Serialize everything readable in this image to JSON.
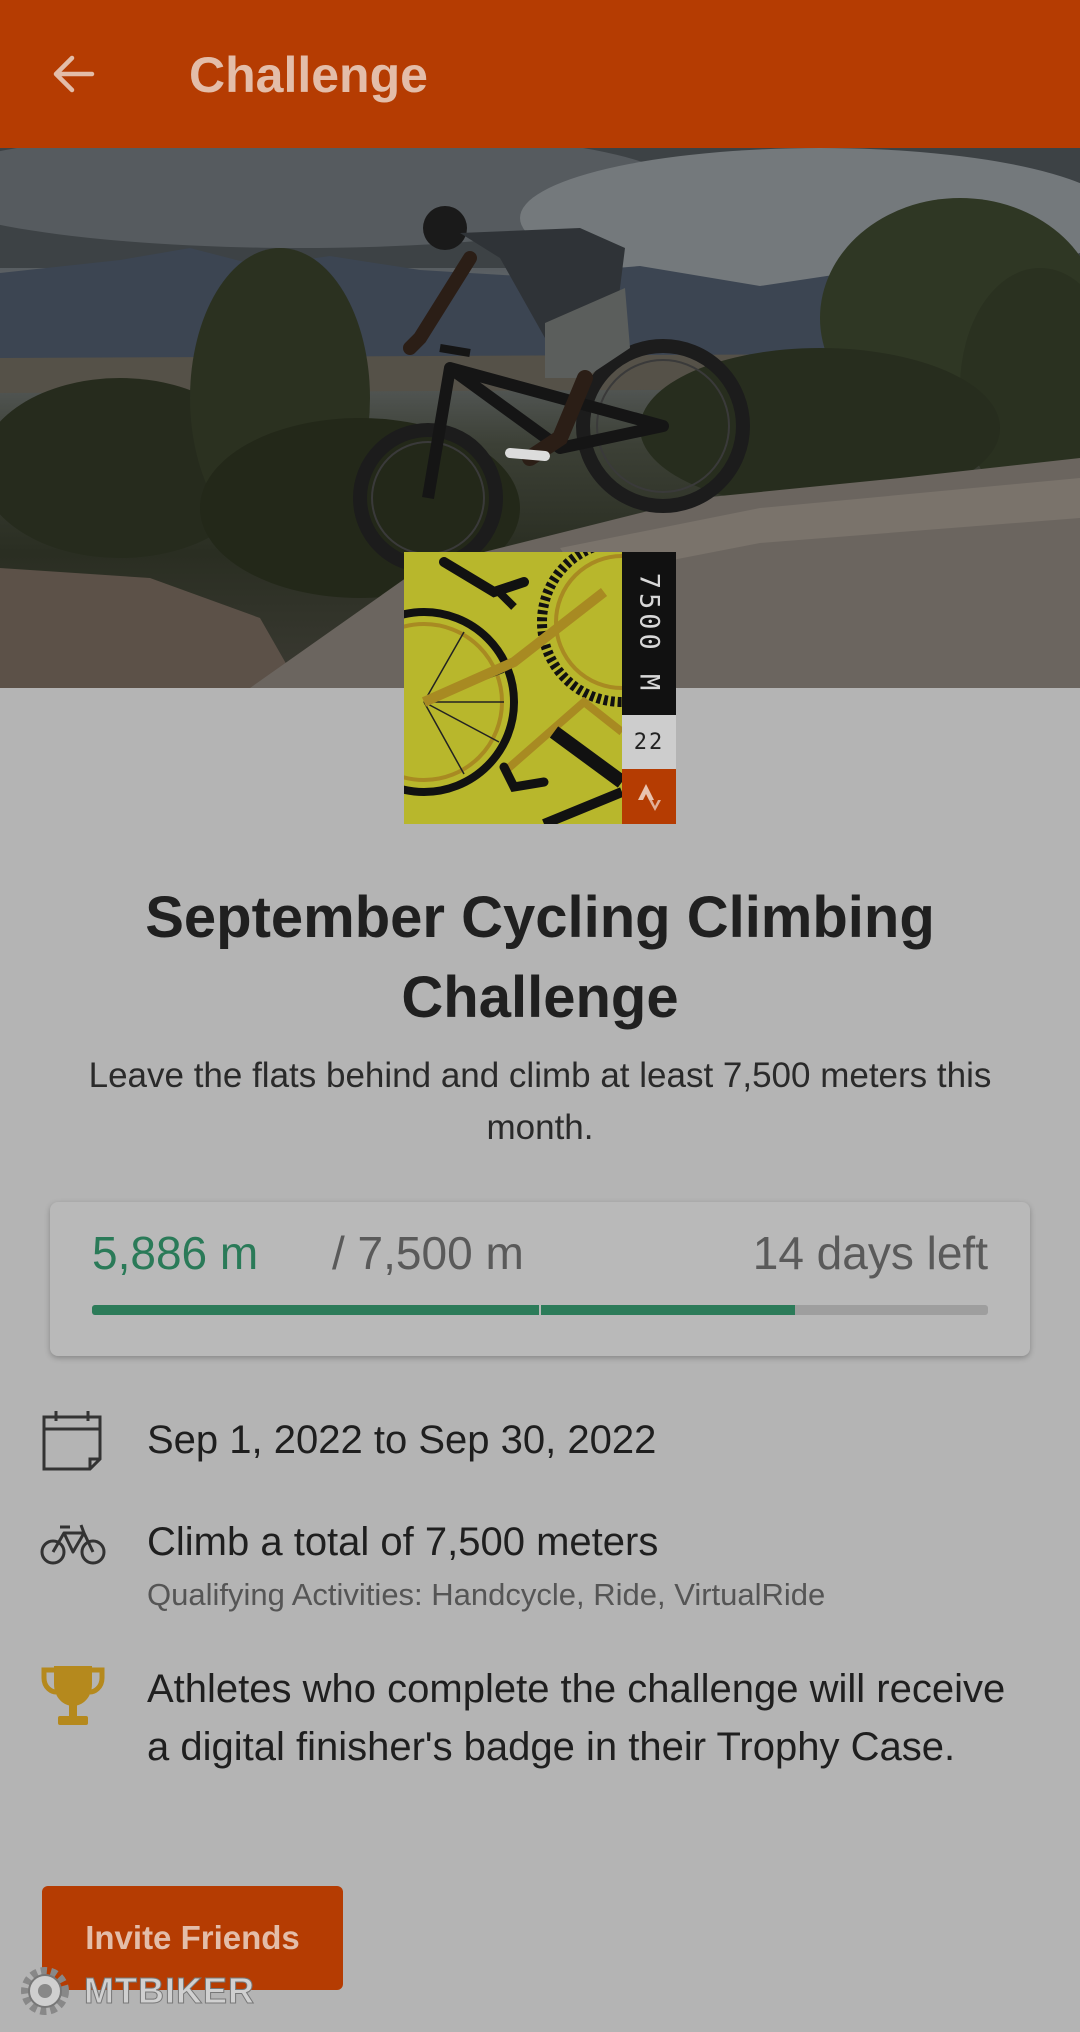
{
  "appbar": {
    "title": "Challenge",
    "back_icon": "arrow-left-icon",
    "background": "#b53c02"
  },
  "hero": {
    "alt": "mountain biker riding over a rock slab"
  },
  "badge": {
    "distance": "7500 M",
    "year": "22",
    "logo_icon": "strava-logo-icon"
  },
  "challenge": {
    "title": "September Cycling Climbing Challenge",
    "description": "Leave the flats behind and climb at least 7,500 meters this month."
  },
  "progress": {
    "current": "5,886 m",
    "target": "/ 7,500 m",
    "days_left": "14 days left",
    "fraction": 0.785,
    "accent": "#2c7b59"
  },
  "details": {
    "dates": "Sep 1, 2022 to Sep 30, 2022",
    "goal": "Climb a total of 7,500 meters",
    "qualifying": "Qualifying Activities: Handcycle, Ride, VirtualRide",
    "reward": "Athletes who complete the challenge will receive a digital finisher's badge in their Trophy Case.",
    "trophy_color": "#b5891d"
  },
  "actions": {
    "invite_label": "Invite Friends"
  },
  "watermark": {
    "text": "MTBIKER"
  }
}
